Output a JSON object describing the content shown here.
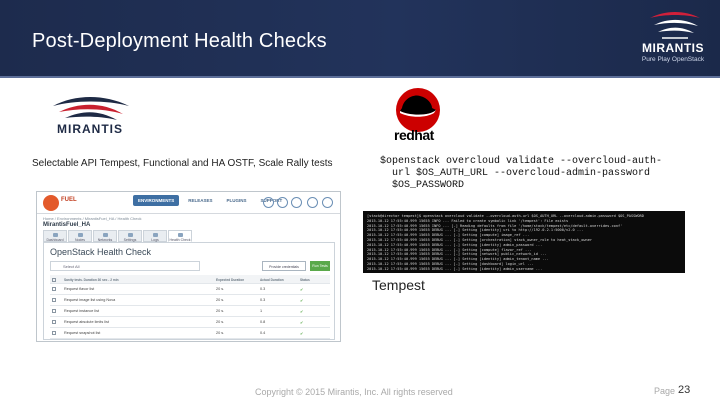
{
  "slide": {
    "title": "Post-Deployment Health Checks",
    "page_label": "Page",
    "page_number": "23",
    "copyright": "Copyright © 2015 Mirantis, Inc. All rights reserved"
  },
  "brand": {
    "name": "MIRANTIS",
    "tagline": "Pure Play OpenStack",
    "logo_word": "MIRANTIS"
  },
  "left": {
    "caption": "Selectable API Tempest, Functional and HA OSTF, Scale Rally tests"
  },
  "right": {
    "redhat_word": "redhat",
    "command_lines": [
      "$openstack overcloud validate --overcloud-auth-",
      "  url $OS_AUTH_URL --overcloud-admin-password",
      "  $OS_PASSWORD"
    ],
    "terminal_lines": [
      "[stack@director tempest]$ openstack overcloud validate --overcloud-auth-url $OS_AUTH_URL --overcloud-admin-password $OS_PASSWORD",
      "2015-10-12 17:55:40.999 15655 INFO ... Failed to create symbolic link '/tempest': File exists",
      "2015-10-12 17:55:40.999 15655 INFO ... [-] Reading defaults from file '/home/stack/tempest/etc/default-overrides.conf'",
      "2015-10-12 17:55:40.999 15655 DEBUG ... [-] Setting [identity] uri to http://192.0.2.1:5000/v2.0 ...",
      "2015-10-12 17:55:40.999 15655 DEBUG ... [-] Setting [compute] image_ref ...",
      "2015-10-12 17:55:40.999 15655 DEBUG ... [-] Setting [orchestration] stack_owner_role to heat_stack_owner",
      "2015-10-12 17:55:40.999 15655 DEBUG ... [-] Setting [identity] admin_password ...",
      "2015-10-12 17:55:40.999 15655 DEBUG ... [-] Setting [compute] flavor_ref ...",
      "2015-10-12 17:55:40.999 15655 DEBUG ... [-] Setting [network] public_network_id ...",
      "2015-10-12 17:55:40.999 15655 DEBUG ... [-] Setting [identity] admin_tenant_name ...",
      "2015-10-12 17:55:40.999 15655 DEBUG ... [-] Setting [dashboard] login_url ...",
      "2015-10-12 17:55:40.999 15655 DEBUG ... [-] Setting [identity] admin_username ..."
    ],
    "caption": "Tempest"
  },
  "fuel": {
    "logo_text": "FUEL",
    "nav": [
      "ENVIRONMENTS",
      "RELEASES",
      "PLUGINS",
      "SUPPORT"
    ],
    "breadcrumb": "Home / Environments / MirantisFuel_HA / Health Check",
    "env_name": "MirantisFuel_HA",
    "tabs": [
      "Dashboard",
      "Nodes",
      "Networks",
      "Settings",
      "Logs",
      "Health Check"
    ],
    "panel_title": "OpenStack Health Check",
    "filter_placeholder": "Select All",
    "buttons": {
      "provide": "Provide credentials",
      "run": "Run Tests"
    },
    "table_headers": [
      "Sanity tests. Duration 30 sec - 2 min",
      "Expected Duration",
      "Actual Duration",
      "Status"
    ],
    "rows": [
      {
        "name": "Request flavor list",
        "expected": "20 s.",
        "actual": "0.3",
        "status": "✔"
      },
      {
        "name": "Request image list using Nova",
        "expected": "20 s.",
        "actual": "0.3",
        "status": "✔"
      },
      {
        "name": "Request instance list",
        "expected": "20 s.",
        "actual": "1",
        "status": "✔"
      },
      {
        "name": "Request absolute limits list",
        "expected": "20 s.",
        "actual": "0.8",
        "status": "✔"
      },
      {
        "name": "Request snapshot list",
        "expected": "20 s.",
        "actual": "0.4",
        "status": "✔"
      }
    ]
  }
}
